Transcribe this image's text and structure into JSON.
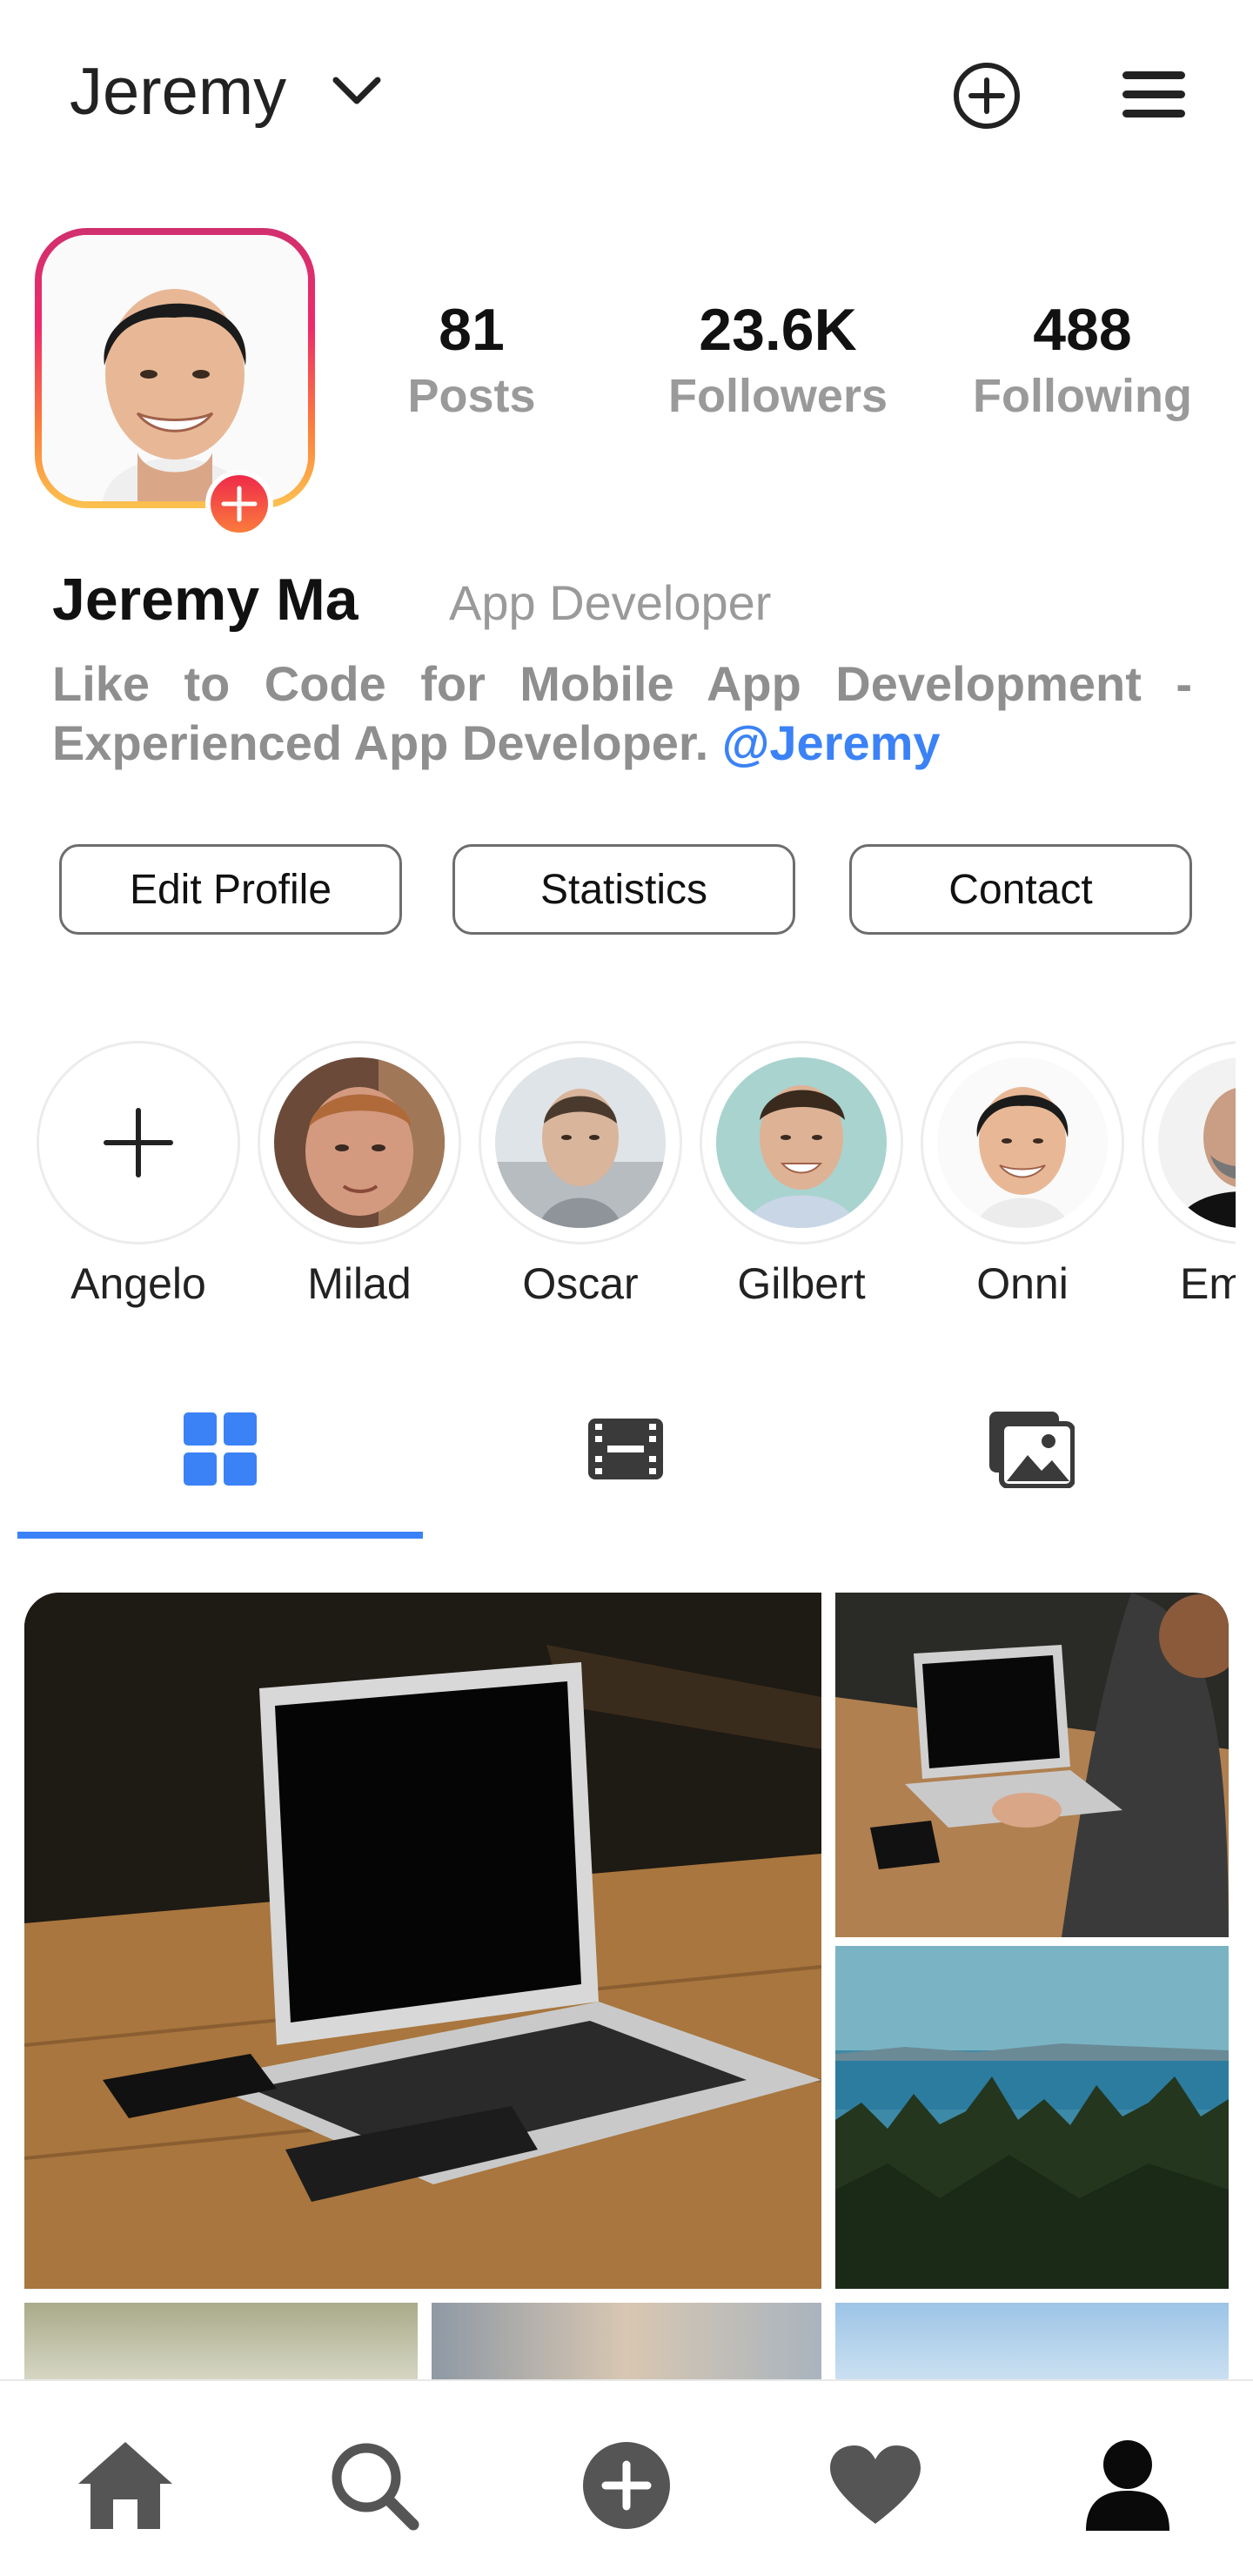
{
  "header": {
    "username": "Jeremy"
  },
  "profile": {
    "stats": [
      {
        "value": "81",
        "label": "Posts"
      },
      {
        "value": "23.6K",
        "label": "Followers"
      },
      {
        "value": "488",
        "label": "Following"
      }
    ],
    "full_name": "Jeremy Ma",
    "title": "App Developer",
    "bio": "Like to Code for Mobile App Development - Experienced App Developer.",
    "bio_mention": "@Jeremy"
  },
  "actions": {
    "edit_profile": "Edit Profile",
    "statistics": "Statistics",
    "contact": "Contact"
  },
  "stories": [
    {
      "name": "Angelo",
      "kind": "add"
    },
    {
      "name": "Milad"
    },
    {
      "name": "Oscar"
    },
    {
      "name": "Gilbert"
    },
    {
      "name": "Onni"
    },
    {
      "name": "Em"
    }
  ],
  "tabs": [
    {
      "icon": "grid-icon",
      "active": true
    },
    {
      "icon": "film-icon",
      "active": false
    },
    {
      "icon": "photos-icon",
      "active": false
    }
  ],
  "bottom_nav": [
    {
      "icon": "home-icon"
    },
    {
      "icon": "search-icon"
    },
    {
      "icon": "add-circle-icon"
    },
    {
      "icon": "heart-icon"
    },
    {
      "icon": "profile-icon",
      "active": true
    }
  ],
  "colors": {
    "accent": "#3b82f6",
    "muted_text": "#9a9a9a",
    "ring_gradient": [
      "#d0306e",
      "#fb7c3c",
      "#fcc24f"
    ]
  }
}
